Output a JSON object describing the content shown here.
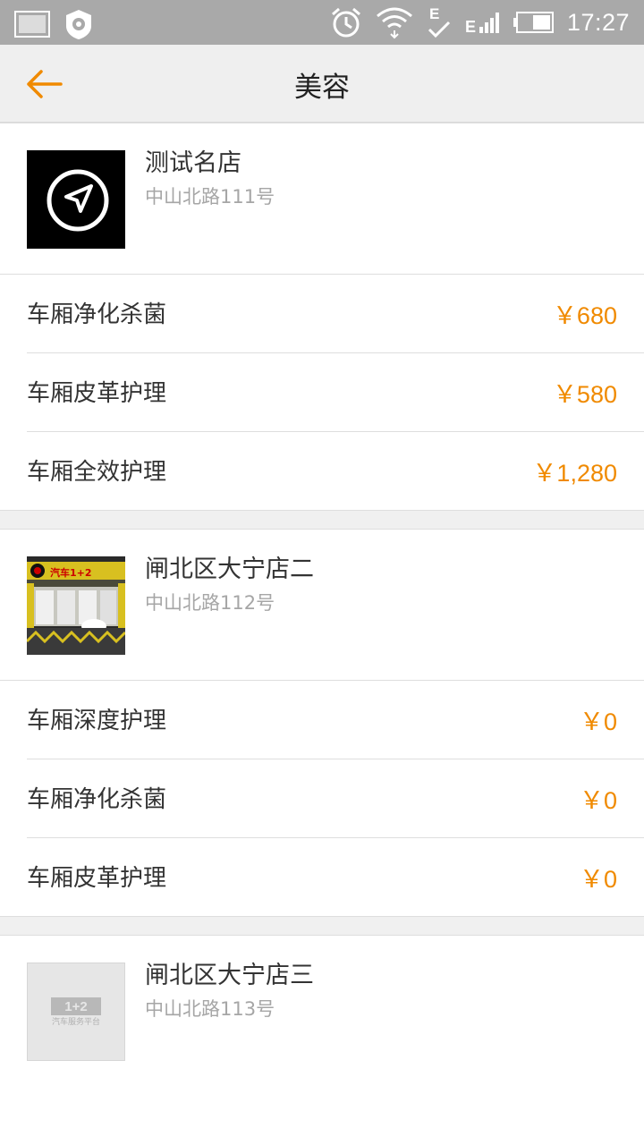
{
  "status_bar": {
    "time": "17:27",
    "network_label": "E"
  },
  "header": {
    "title": "美容"
  },
  "stores": [
    {
      "name": "测试名店",
      "address": "中山北路111号",
      "services": [
        {
          "name": "车厢净化杀菌",
          "price": "￥680"
        },
        {
          "name": "车厢皮革护理",
          "price": "￥580"
        },
        {
          "name": "车厢全效护理",
          "price": "￥1,280"
        }
      ]
    },
    {
      "name": "闸北区大宁店二",
      "address": "中山北路112号",
      "services": [
        {
          "name": "车厢深度护理",
          "price": "￥0"
        },
        {
          "name": "车厢净化杀菌",
          "price": "￥0"
        },
        {
          "name": "车厢皮革护理",
          "price": "￥0"
        }
      ]
    },
    {
      "name": "闸北区大宁店三",
      "address": "中山北路113号",
      "services": []
    }
  ],
  "placeholder_logo": {
    "title": "1+2",
    "subtitle": "汽车服务平台"
  },
  "store2_banner_text": "汽车1+2",
  "colors": {
    "accent": "#f08a00",
    "status_bar": "#a9a9a9",
    "app_bar": "#efefef"
  }
}
